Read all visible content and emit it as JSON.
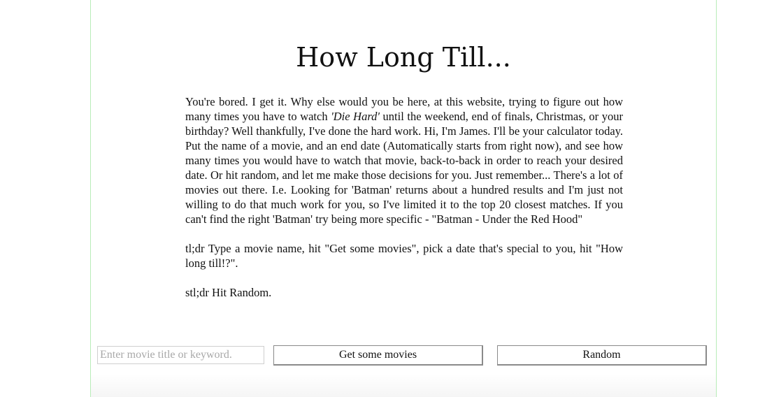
{
  "page": {
    "title": "How Long Till..."
  },
  "intro": {
    "p1_before_italic": "You're bored. I get it. Why else would you be here, at this website, trying to figure out how many times you have to watch ",
    "p1_italic": "'Die Hard'",
    "p1_after_italic": " until the weekend, end of finals, Christmas, or your birthday? Well thankfully, I've done the hard work. Hi, I'm James. I'll be your calculator today. Put the name of a movie, and an end date (Automatically starts from right now), and see how many times you would have to watch that movie, back-to-back in order to reach your desired date. Or hit random, and let me make those decisions for you. Just remember... There's a lot of movies out there. I.e. Looking for 'Batman' returns about a hundred results and I'm just not willing to do that much work for you, so I've limited it to the top 20 closest matches. If you can't find the right 'Batman' try being more specific - \"Batman - Under the Red Hood\"",
    "p2": "tl;dr Type a movie name, hit \"Get some movies\", pick a date that's special to you, hit \"How long till!?\".",
    "p3": "stl;dr Hit Random."
  },
  "controls": {
    "search_placeholder": "Enter movie title or keyword.",
    "search_value": "",
    "get_movies_label": "Get some movies",
    "random_label": "Random"
  }
}
